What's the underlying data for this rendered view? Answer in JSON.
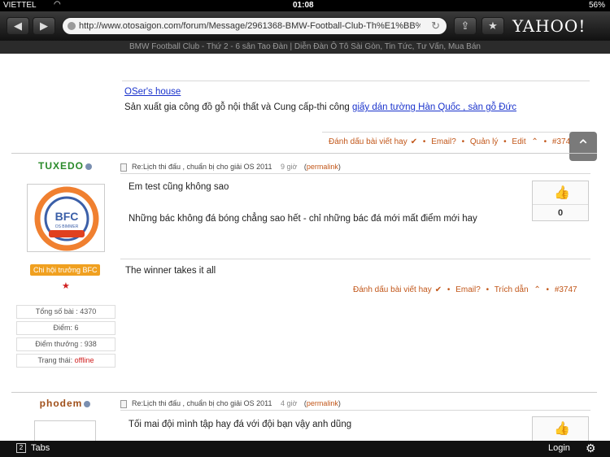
{
  "status": {
    "carrier": "VIETTEL",
    "time": "01:08",
    "battery": "56%"
  },
  "browser": {
    "url": "http://www.otosaigon.com/forum/Message/2961368-BMW-Football-Club-Th%E1%BB%A...",
    "page_title": "BMW Football Club - Thứ 2 - 6 sân Tao Đàn | Diễn Đàn Ô Tô Sài Gòn, Tin Tức, Tư Vấn, Mua Bán",
    "yahoo": "YAHOO!"
  },
  "signature": {
    "link": "OSer's house",
    "text": "Sản xuất gia công đồ gỗ nội thất và Cung cấp-thi công",
    "text_link": "giấy dán tường Hàn Quốc , sàn gỗ Đức"
  },
  "post0_actions": {
    "mark": "Đánh dấu bài viết hay",
    "email": "Email?",
    "manage": "Quản lý",
    "edit": "Edit",
    "num": "#3746"
  },
  "post1": {
    "username": "TUXEDO",
    "rank": "Chi hội trưởng BFC",
    "stats": {
      "posts": "Tổng số bài : 4370",
      "points": "Điểm: 6",
      "bonus": "Điểm thưởng : 938",
      "state_label": "Trạng thái:",
      "state": "offline"
    },
    "subject": "Re:Lịch thi đấu , chuẩn bị cho giải OS 2011",
    "ago": "9 giờ",
    "permalink": "permalink",
    "line1": "Em test cũng không sao",
    "line2": "Những bác không đá bóng chẳng sao hết - chỉ những bác đá mới mất điểm mới hay",
    "likes": "0",
    "signature": "The winner takes it all",
    "actions": {
      "mark": "Đánh dấu bài viết hay",
      "email": "Email?",
      "quote": "Trích dẫn",
      "num": "#3747"
    }
  },
  "post2": {
    "username": "phodem",
    "subject": "Re:Lịch thi đấu , chuẩn bị cho giải OS 2011",
    "ago": "4 giờ",
    "permalink": "permalink",
    "line1": "Tối mai đội mình tập hay đá với đội bạn vậy anh dũng"
  },
  "bottom": {
    "tabs": "Tabs",
    "tabs_count": "2",
    "login": "Login"
  },
  "colors": {
    "accent": "#c2571a",
    "link": "#1a33cc",
    "username": "#2a8a2a",
    "badge": "#f0a020"
  }
}
